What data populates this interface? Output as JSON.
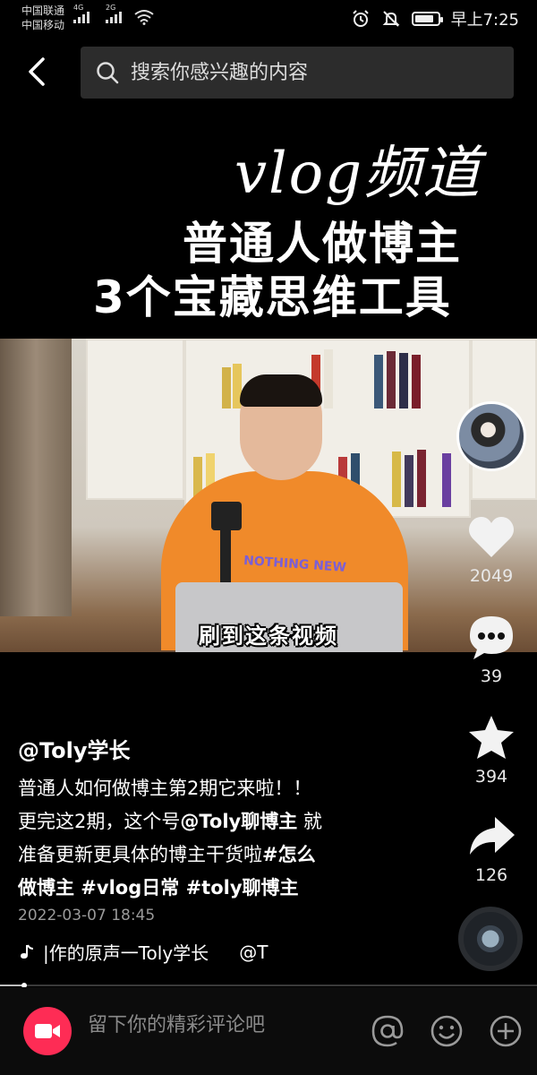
{
  "status_bar": {
    "carrier1": "中国联通",
    "carrier2": "中国移动",
    "net1": "4G",
    "net2": "2G",
    "time": "早上7:25",
    "icons": [
      "signal-icon",
      "wifi-icon",
      "alarm-icon",
      "mute-icon",
      "battery-icon"
    ]
  },
  "search": {
    "placeholder": "搜索你感兴趣的内容"
  },
  "cover": {
    "handwriting": "vlog频道",
    "title_line1": "普通人做博主",
    "title_line2": "3个宝藏思维工具"
  },
  "video": {
    "subtitle": "刷到这条视频",
    "hoodie_text": "NOTHING NEW",
    "progress": 0.045
  },
  "actions": {
    "likes": "2049",
    "comments": "39",
    "favorites": "394",
    "shares": "126"
  },
  "caption": {
    "author": "@Toly学长",
    "line1": "普通人如何做博主第2期它来啦！！",
    "line2_pre": "更完这2期，这个号",
    "line2_mention": "@Toly聊博主",
    "line2_post": " 就",
    "line3_pre": "准备更新更具体的博主干货啦",
    "line3_tag": "#怎么",
    "line4": "做博主 #vlog日常 #toly聊博主",
    "date": "2022-03-07 18:45",
    "music": "|作的原声一Toly学长",
    "music_mention": "@T"
  },
  "comment_bar": {
    "placeholder": "留下你的精彩评论吧"
  },
  "colors": {
    "accent": "#fe2c55",
    "background": "#000000",
    "search_bg": "#2c2c2c"
  }
}
